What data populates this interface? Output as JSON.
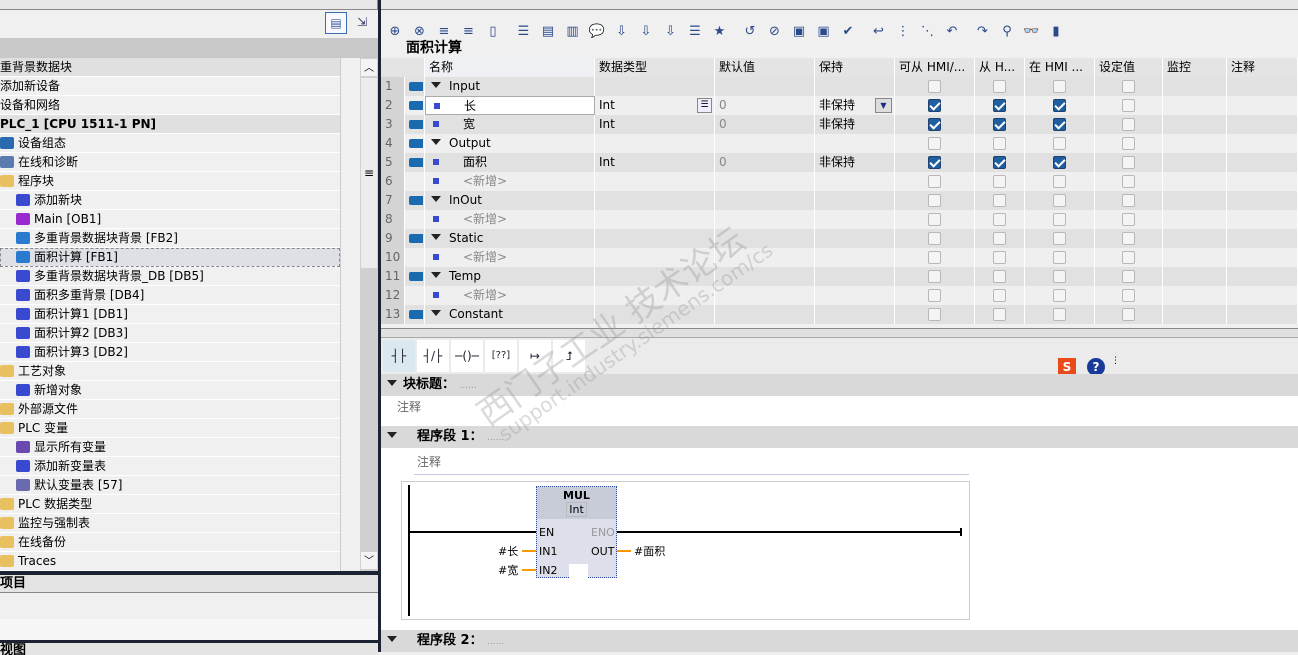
{
  "left_panel": {
    "tree": [
      {
        "label": "重背景数据块",
        "icon": "db-icon",
        "indent": 0,
        "header": true
      },
      {
        "label": "添加新设备",
        "icon": "",
        "indent": 0
      },
      {
        "label": "设备和网络",
        "icon": "",
        "indent": 0
      },
      {
        "label": "PLC_1 [CPU 1511-1 PN]",
        "icon": "",
        "indent": 0,
        "header": true,
        "bold": true
      },
      {
        "label": "设备组态",
        "icon": "device-config-icon",
        "indent": 1
      },
      {
        "label": "在线和诊断",
        "icon": "diagnostics-icon",
        "indent": 1
      },
      {
        "label": "程序块",
        "icon": "folder-icon",
        "indent": 1
      },
      {
        "label": "添加新块",
        "icon": "add-block-icon",
        "indent": 2
      },
      {
        "label": "Main [OB1]",
        "icon": "ob-block-icon",
        "indent": 2
      },
      {
        "label": "多重背景数据块背景 [FB2]",
        "icon": "fb-block-icon",
        "indent": 2
      },
      {
        "label": "面积计算 [FB1]",
        "icon": "fb-block-icon",
        "indent": 2,
        "selected": true
      },
      {
        "label": "多重背景数据块背景_DB [DB5]",
        "icon": "db-block-icon",
        "indent": 2
      },
      {
        "label": "面积多重背景 [DB4]",
        "icon": "db-block-icon",
        "indent": 2
      },
      {
        "label": "面积计算1 [DB1]",
        "icon": "db-block-icon",
        "indent": 2
      },
      {
        "label": "面积计算2 [DB3]",
        "icon": "db-block-icon",
        "indent": 2
      },
      {
        "label": "面积计算3 [DB2]",
        "icon": "db-block-icon",
        "indent": 2
      },
      {
        "label": "工艺对象",
        "icon": "folder-icon",
        "indent": 1
      },
      {
        "label": "新增对象",
        "icon": "add-object-icon",
        "indent": 2
      },
      {
        "label": "外部源文件",
        "icon": "folder-icon",
        "indent": 1
      },
      {
        "label": "PLC 变量",
        "icon": "folder-icon",
        "indent": 1
      },
      {
        "label": "显示所有变量",
        "icon": "tags-icon",
        "indent": 2
      },
      {
        "label": "添加新变量表",
        "icon": "add-tag-table-icon",
        "indent": 2
      },
      {
        "label": "默认变量表 [57]",
        "icon": "tag-table-icon",
        "indent": 2
      },
      {
        "label": "PLC 数据类型",
        "icon": "folder-icon",
        "indent": 1
      },
      {
        "label": "监控与强制表",
        "icon": "folder-icon",
        "indent": 1
      },
      {
        "label": "在线备份",
        "icon": "folder-icon",
        "indent": 1
      },
      {
        "label": "Traces",
        "icon": "folder-icon",
        "indent": 1
      }
    ],
    "details_title": "项目",
    "view_title": "视图"
  },
  "editor": {
    "title": "面积计算",
    "columns": [
      "名称",
      "数据类型",
      "默认值",
      "保持",
      "可从 HMI/...",
      "从 H...",
      "在 HMI ...",
      "设定值",
      "监控",
      "注释"
    ],
    "rows": [
      {
        "n": "1",
        "section": true,
        "name": "Input",
        "type": "",
        "default": "",
        "retain": "",
        "hmi": [
          false,
          false,
          false
        ],
        "icon": true
      },
      {
        "n": "2",
        "name": "长",
        "type": "Int",
        "default": "0",
        "retain": "非保持",
        "hmi": [
          true,
          true,
          true
        ],
        "icon": true,
        "editing": true
      },
      {
        "n": "3",
        "name": "宽",
        "type": "Int",
        "default": "0",
        "retain": "非保持",
        "hmi": [
          true,
          true,
          true
        ],
        "icon": true
      },
      {
        "n": "4",
        "section": true,
        "name": "Output",
        "type": "",
        "default": "",
        "retain": "",
        "hmi": [
          false,
          false,
          false
        ],
        "icon": true
      },
      {
        "n": "5",
        "name": "面积",
        "type": "Int",
        "default": "0",
        "retain": "非保持",
        "hmi": [
          true,
          true,
          true
        ],
        "icon": true
      },
      {
        "n": "6",
        "name": "<新增>",
        "add": true,
        "hmi": [
          false,
          false,
          false
        ]
      },
      {
        "n": "7",
        "section": true,
        "name": "InOut",
        "hmi": [
          false,
          false,
          false
        ],
        "icon": true
      },
      {
        "n": "8",
        "name": "<新增>",
        "add": true,
        "hmi": [
          false,
          false,
          false
        ]
      },
      {
        "n": "9",
        "section": true,
        "name": "Static",
        "hmi": [
          false,
          false,
          false
        ],
        "icon": true
      },
      {
        "n": "10",
        "name": "<新增>",
        "add": true,
        "hmi": [
          false,
          false,
          false
        ]
      },
      {
        "n": "11",
        "section": true,
        "name": "Temp",
        "hmi": [
          false,
          false,
          false
        ],
        "icon": true
      },
      {
        "n": "12",
        "name": "<新增>",
        "add": true,
        "hmi": [
          false,
          false,
          false
        ]
      },
      {
        "n": "13",
        "section": true,
        "name": "Constant",
        "hmi": [
          false,
          false,
          false
        ],
        "icon": true
      }
    ]
  },
  "ladder": {
    "block_title_label": "块标题：",
    "block_title_value": "......",
    "comment_placeholder": "注释",
    "networks": [
      {
        "label": "程序段 1：",
        "title": "......",
        "comment": "注释"
      },
      {
        "label": "程序段 2：",
        "title": "......"
      }
    ],
    "box": {
      "name": "MUL",
      "type": "Int",
      "en": "EN",
      "eno": "ENO",
      "in1": "IN1",
      "in2": "IN2",
      "out": "OUT",
      "in1_operand": "#长",
      "in2_operand": "#宽",
      "out_operand": "#面积"
    }
  },
  "watermark": {
    "line1": "西门子工业 技术论坛",
    "line2": "support.industry.siemens.com/cs"
  },
  "colors": {
    "accent": "#1f5f9f",
    "wire": "#ff9900",
    "box": "#c8ccd8"
  }
}
